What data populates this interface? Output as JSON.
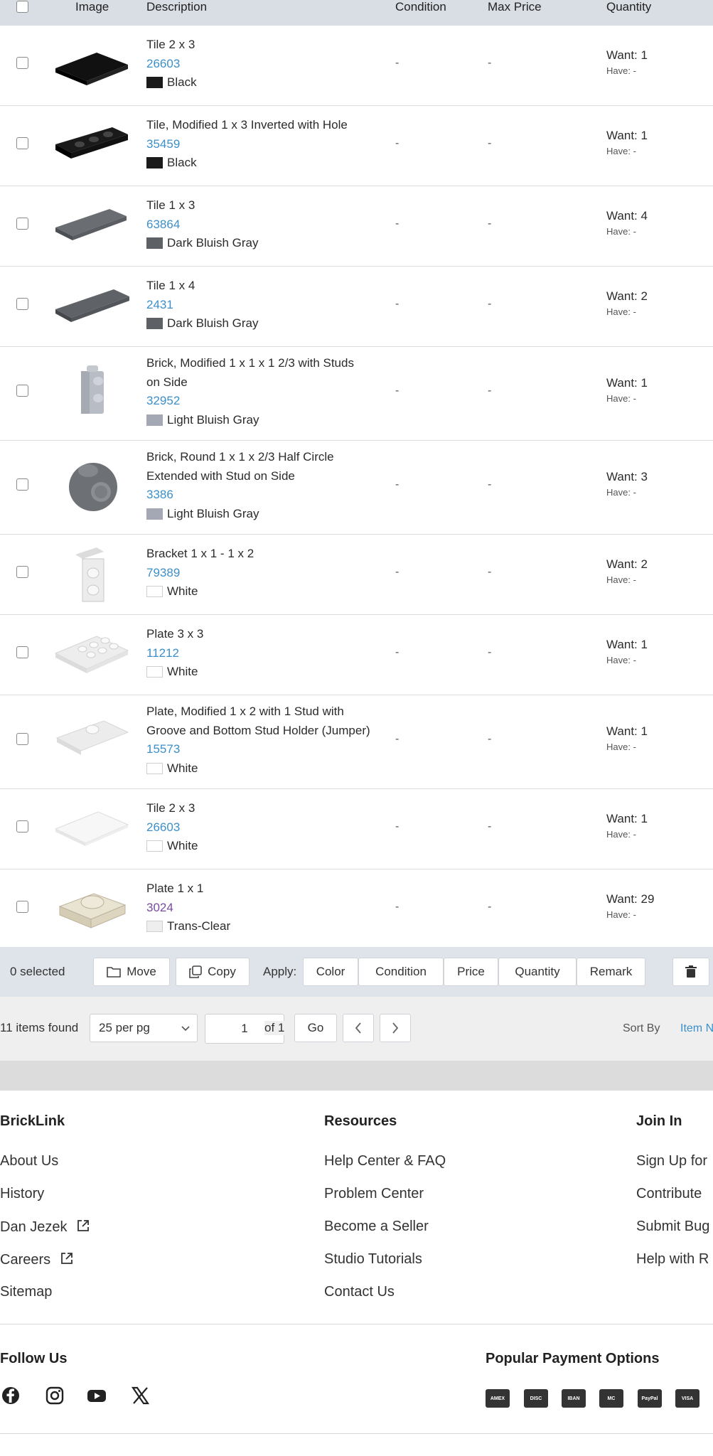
{
  "table": {
    "headers": {
      "image": "Image",
      "description": "Description",
      "condition": "Condition",
      "max_price": "Max Price",
      "quantity": "Quantity"
    },
    "items": [
      {
        "name": "Tile 2 x 3",
        "number": "26603",
        "color": "Black",
        "swatch": "#1b1b1b",
        "condition": "-",
        "max_price": "-",
        "want": "Want: 1",
        "have": "Have: -"
      },
      {
        "name": "Tile, Modified 1 x 3 Inverted with Hole",
        "number": "35459",
        "color": "Black",
        "swatch": "#1b1b1b",
        "condition": "-",
        "max_price": "-",
        "want": "Want: 1",
        "have": "Have: -"
      },
      {
        "name": "Tile 1 x 3",
        "number": "63864",
        "color": "Dark Bluish Gray",
        "swatch": "#5d6064",
        "condition": "-",
        "max_price": "-",
        "want": "Want: 4",
        "have": "Have: -"
      },
      {
        "name": "Tile 1 x 4",
        "number": "2431",
        "color": "Dark Bluish Gray",
        "swatch": "#5d6064",
        "condition": "-",
        "max_price": "-",
        "want": "Want: 2",
        "have": "Have: -"
      },
      {
        "name_line1": "Brick, Modified 1 x 1 x 1 2/3 with Studs",
        "name_line2": "on Side",
        "number": "32952",
        "color": "Light Bluish Gray",
        "swatch": "#a3a8b4",
        "condition": "-",
        "max_price": "-",
        "want": "Want: 1",
        "have": "Have: -"
      },
      {
        "name_line1": "Brick, Round 1 x 1 x 2/3 Half Circle",
        "name_line2": "Extended with Stud on Side",
        "number": "3386",
        "color": "Light Bluish Gray",
        "swatch": "#a3a8b4",
        "condition": "-",
        "max_price": "-",
        "want": "Want: 3",
        "have": "Have: -"
      },
      {
        "name": "Bracket 1 x 1 - 1 x 2",
        "number": "79389",
        "color": "White",
        "swatch": "#ffffff",
        "condition": "-",
        "max_price": "-",
        "want": "Want: 2",
        "have": "Have: -"
      },
      {
        "name": "Plate 3 x 3",
        "number": "11212",
        "color": "White",
        "swatch": "#ffffff",
        "condition": "-",
        "max_price": "-",
        "want": "Want: 1",
        "have": "Have: -"
      },
      {
        "name_line1": "Plate, Modified 1 x 2 with 1 Stud with",
        "name_line2": "Groove and Bottom Stud Holder (Jumper)",
        "number": "15573",
        "color": "White",
        "swatch": "#ffffff",
        "condition": "-",
        "max_price": "-",
        "want": "Want: 1",
        "have": "Have: -"
      },
      {
        "name": "Tile 2 x 3",
        "number": "26603",
        "color": "White",
        "swatch": "#ffffff",
        "condition": "-",
        "max_price": "-",
        "want": "Want: 1",
        "have": "Have: -"
      },
      {
        "name": "Plate 1 x 1",
        "number": "3024",
        "color": "Trans-Clear",
        "swatch": "#eeeeee",
        "condition": "-",
        "max_price": "-",
        "want": "Want: 29",
        "have": "Have: -"
      }
    ]
  },
  "actions": {
    "selected": "0 selected",
    "move": "Move",
    "copy": "Copy",
    "apply": "Apply:",
    "color": "Color",
    "condition": "Condition",
    "price": "Price",
    "quantity": "Quantity",
    "remark": "Remark"
  },
  "pagination": {
    "found": "11 items found",
    "per_page": "25 per pg",
    "page_value": "1",
    "of": "of 1",
    "go": "Go",
    "sort_by": "Sort By",
    "sort_value": "Item N"
  },
  "footer": {
    "col1": {
      "title": "BrickLink",
      "links": [
        "About Us",
        "History",
        "Dan Jezek",
        "Careers",
        "Sitemap"
      ]
    },
    "col2": {
      "title": "Resources",
      "links": [
        "Help Center & FAQ",
        "Problem Center",
        "Become a Seller",
        "Studio Tutorials",
        "Contact Us"
      ]
    },
    "col3": {
      "title": "Join In",
      "links": [
        "Sign Up for",
        "Contribute",
        "Submit Bug",
        "Help with R"
      ]
    },
    "follow_us": "Follow Us",
    "payment_title": "Popular Payment Options",
    "social_icons": [
      "facebook-icon",
      "instagram-icon",
      "youtube-icon",
      "x-icon"
    ],
    "payment_icons": [
      "amex",
      "discover",
      "iban",
      "mastercard",
      "paypal",
      "visa"
    ],
    "payment_labels": {
      "amex": "AMEX",
      "discover": "DISC",
      "iban": "IBAN",
      "mastercard": "MC",
      "paypal": "PayPal",
      "visa": "VISA"
    }
  }
}
